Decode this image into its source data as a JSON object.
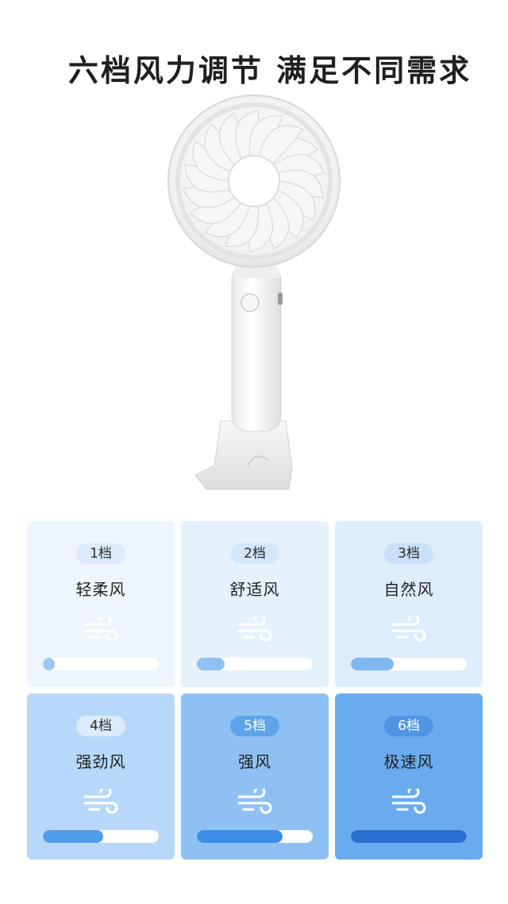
{
  "headline": "六档风力调节 满足不同需求",
  "modes": [
    {
      "badge": "1档",
      "name": "轻柔风",
      "level": 0.1,
      "card_bg": "#eef5fd",
      "badge_bg": "#dceafb",
      "badge_fg": "#2b2b2b",
      "fill": "#9cc8f4",
      "icon": "#ffffff"
    },
    {
      "badge": "2档",
      "name": "舒适风",
      "level": 0.24,
      "card_bg": "#e6f1fd",
      "badge_bg": "#d3e6fa",
      "badge_fg": "#2b2b2b",
      "fill": "#8fc1f3",
      "icon": "#ffffff"
    },
    {
      "badge": "3档",
      "name": "自然风",
      "level": 0.37,
      "card_bg": "#ddedfc",
      "badge_bg": "#c8e0fa",
      "badge_fg": "#2b2b2b",
      "fill": "#82b8f2",
      "icon": "#ffffff"
    },
    {
      "badge": "4档",
      "name": "强劲风",
      "level": 0.52,
      "card_bg": "#b7d8f9",
      "badge_bg": "#dbeafc",
      "badge_fg": "#2b2b2b",
      "fill": "#4f9de9",
      "icon": "#ffffff"
    },
    {
      "badge": "5档",
      "name": "强风",
      "level": 0.74,
      "card_bg": "#8ec0f4",
      "badge_bg": "#5ea4ea",
      "badge_fg": "#ffffff",
      "fill": "#3b8ee6",
      "icon": "#ffffff"
    },
    {
      "badge": "6档",
      "name": "极速风",
      "level": 1.0,
      "card_bg": "#6aabf0",
      "badge_bg": "#4f95e4",
      "badge_fg": "#ffffff",
      "fill": "#2a6fcf",
      "icon": "#ffffff"
    }
  ]
}
